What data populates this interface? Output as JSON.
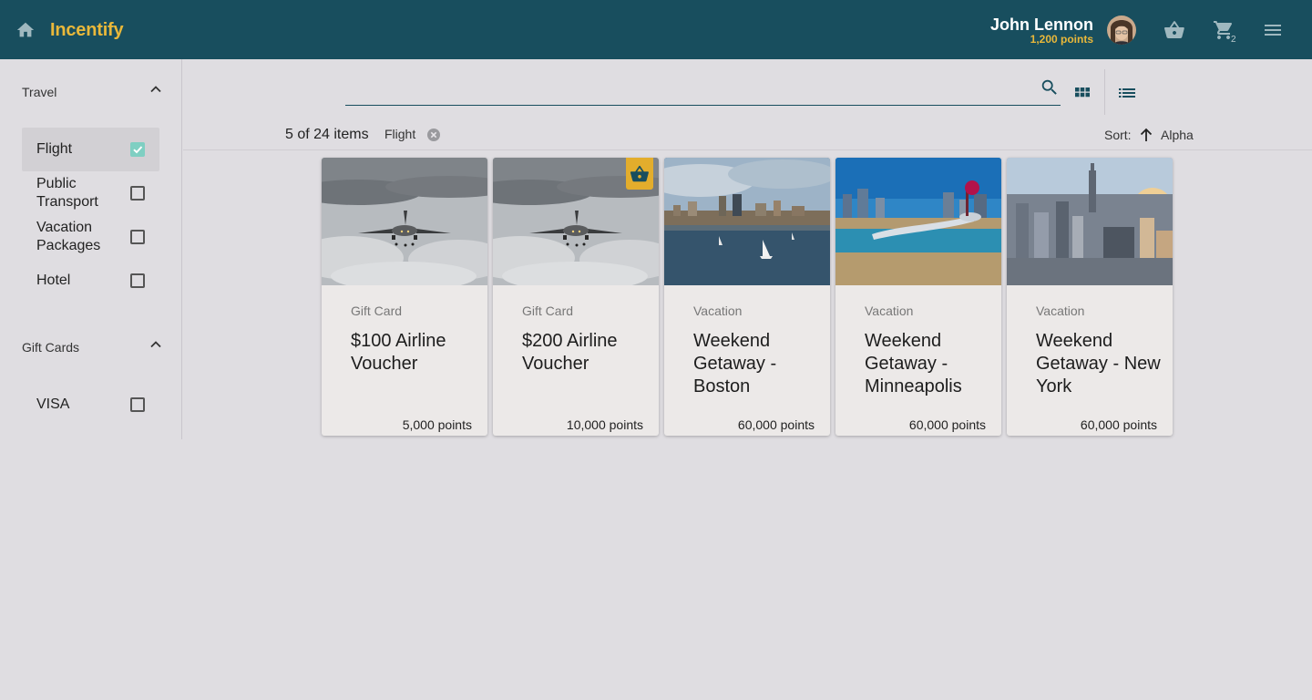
{
  "header": {
    "brand": "Incentify",
    "user_name": "John Lennon",
    "user_points": "1,200 points",
    "cart_count": "2",
    "icons": [
      "home-icon",
      "basket-icon",
      "cart-icon",
      "menu-icon"
    ],
    "colors": {
      "bar": "#184e5e",
      "brand": "#e9b83a"
    }
  },
  "sidebar": {
    "sections": [
      {
        "title": "Travel",
        "items": [
          {
            "label": "Flight",
            "checked": true
          },
          {
            "label": "Public Transport",
            "checked": false
          },
          {
            "label": "Vacation Packages",
            "checked": false
          },
          {
            "label": "Hotel",
            "checked": false
          }
        ]
      },
      {
        "title": "Gift Cards",
        "items": [
          {
            "label": "VISA",
            "checked": false
          }
        ]
      }
    ]
  },
  "search": {
    "value": "",
    "placeholder": ""
  },
  "results": {
    "count_text": "5 of 24 items",
    "active_filter": "Flight",
    "sort_label": "Sort:",
    "sort_value": "Alpha",
    "sort_direction": "ascending"
  },
  "cards": [
    {
      "category": "Gift Card",
      "title": "$100 Airline Voucher",
      "points": "5,000 points",
      "image": "airplane",
      "in_basket": false
    },
    {
      "category": "Gift Card",
      "title": "$200 Airline Voucher",
      "points": "10,000 points",
      "image": "airplane",
      "in_basket": true
    },
    {
      "category": "Vacation",
      "title": "Weekend Getaway - Boston",
      "points": "60,000 points",
      "image": "boston-harbor",
      "in_basket": false
    },
    {
      "category": "Vacation",
      "title": "Weekend Getaway - Minneapolis",
      "points": "60,000 points",
      "image": "minneapolis-sculpture",
      "in_basket": false
    },
    {
      "category": "Vacation",
      "title": "Weekend Getaway - New York",
      "points": "60,000 points",
      "image": "new-york-skyline",
      "in_basket": false
    }
  ]
}
